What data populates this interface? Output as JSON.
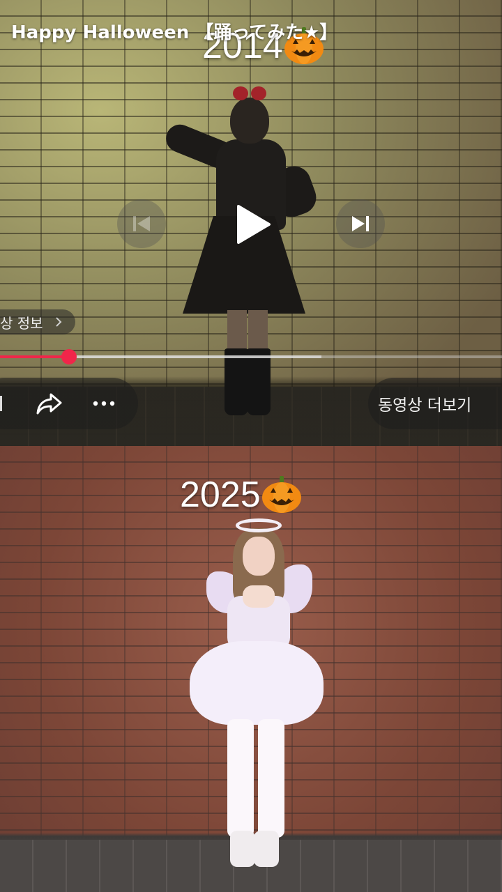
{
  "video_title": "Happy Halloween 【踊ってみた★】",
  "top_clip": {
    "year_label": "2014",
    "year_icon": "pumpkin-icon"
  },
  "bottom_clip": {
    "year_label": "2025",
    "year_icon": "pumpkin-icon"
  },
  "player": {
    "info_label": "상 정보",
    "more_videos_label": "동영상 더보기",
    "progress_played_fraction": 0.138,
    "progress_buffered_fraction": 0.64,
    "icons": [
      "previous-icon",
      "play-icon",
      "next-icon",
      "share-icon",
      "more-icon",
      "chevron-right-icon"
    ],
    "accent_color": "#f0264a"
  }
}
